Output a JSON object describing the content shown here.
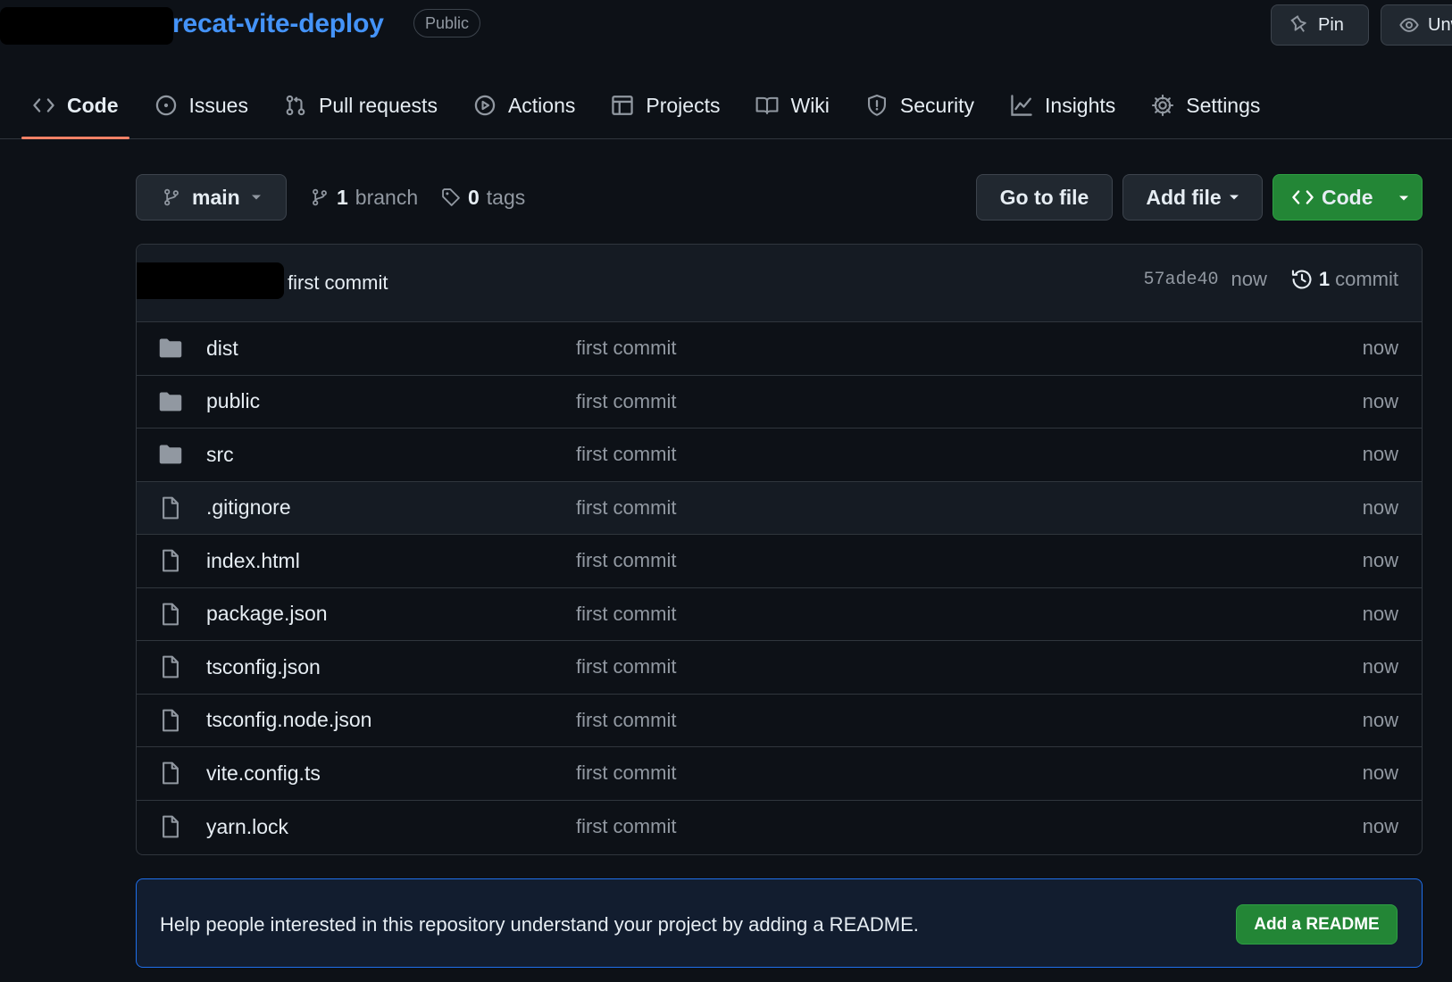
{
  "header": {
    "repo_name": "recat-vite-deploy",
    "visibility": "Public",
    "pin_label": "Pin",
    "watch_label": "Unwatch"
  },
  "tabs": [
    {
      "label": "Code",
      "icon": "code-icon",
      "active": true
    },
    {
      "label": "Issues",
      "icon": "issue-icon"
    },
    {
      "label": "Pull requests",
      "icon": "pull-request-icon"
    },
    {
      "label": "Actions",
      "icon": "play-icon"
    },
    {
      "label": "Projects",
      "icon": "table-icon"
    },
    {
      "label": "Wiki",
      "icon": "book-icon"
    },
    {
      "label": "Security",
      "icon": "shield-icon"
    },
    {
      "label": "Insights",
      "icon": "graph-icon"
    },
    {
      "label": "Settings",
      "icon": "gear-icon"
    }
  ],
  "toolbar": {
    "branch": "main",
    "branch_count": "1",
    "branch_word": "branch",
    "tag_count": "0",
    "tag_word": "tags",
    "go_to_file": "Go to file",
    "add_file": "Add file",
    "code_label": "Code"
  },
  "latest_commit": {
    "message": "first commit",
    "sha": "57ade40",
    "time": "now",
    "count": "1",
    "count_word": "commit"
  },
  "files": [
    {
      "name": "dist",
      "type": "dir",
      "message": "first commit",
      "time": "now"
    },
    {
      "name": "public",
      "type": "dir",
      "message": "first commit",
      "time": "now"
    },
    {
      "name": "src",
      "type": "dir",
      "message": "first commit",
      "time": "now"
    },
    {
      "name": ".gitignore",
      "type": "file",
      "message": "first commit",
      "time": "now"
    },
    {
      "name": "index.html",
      "type": "file",
      "message": "first commit",
      "time": "now"
    },
    {
      "name": "package.json",
      "type": "file",
      "message": "first commit",
      "time": "now"
    },
    {
      "name": "tsconfig.json",
      "type": "file",
      "message": "first commit",
      "time": "now"
    },
    {
      "name": "tsconfig.node.json",
      "type": "file",
      "message": "first commit",
      "time": "now"
    },
    {
      "name": "vite.config.ts",
      "type": "file",
      "message": "first commit",
      "time": "now"
    },
    {
      "name": "yarn.lock",
      "type": "file",
      "message": "first commit",
      "time": "now"
    }
  ],
  "readme": {
    "text": "Help people interested in this repository understand your project by adding a README.",
    "button": "Add a README"
  },
  "colors": {
    "background": "#0d1117",
    "accent_blue": "#4493f8",
    "primary_green": "#238636",
    "active_tab_underline": "#f78166"
  }
}
